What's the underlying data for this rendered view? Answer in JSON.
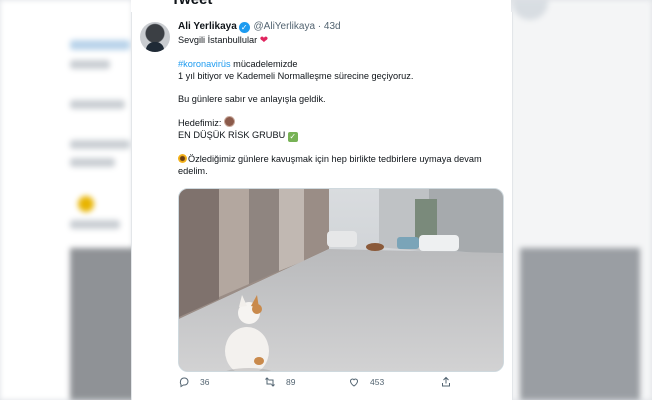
{
  "header": {
    "title": "Tweet"
  },
  "tweet": {
    "name": "Ali Yerlikaya",
    "handle": "@AliYerlikaya",
    "separator": "·",
    "time": "43d",
    "line1": "Sevgili İstanbullular",
    "hashtag": "#koronavirüs",
    "line2_rest": " mücadelemizde",
    "line3": "1 yıl bitiyor ve Kademeli Normalleşme sürecine geçiyoruz.",
    "line4": "Bu günlere sabır ve anlayışla geldik.",
    "line5": "Hedefimiz:",
    "line6": "EN DÜŞÜK RİSK GRUBU",
    "line7": "Özlediğimiz günlere kavuşmak için hep birlikte tedbirlere uymaya devam edelim."
  },
  "actions": {
    "replies": "36",
    "retweets": "89",
    "likes": "453"
  },
  "icons": [
    "verified-badge-icon",
    "heart-emoji-icon",
    "face-emoji-icon",
    "check-mark-icon",
    "sunflower-icon",
    "reply-icon",
    "retweet-icon",
    "like-icon",
    "share-icon"
  ],
  "colors": {
    "link": "#1d9bf0",
    "text": "#0f1419",
    "muted": "#536471"
  }
}
